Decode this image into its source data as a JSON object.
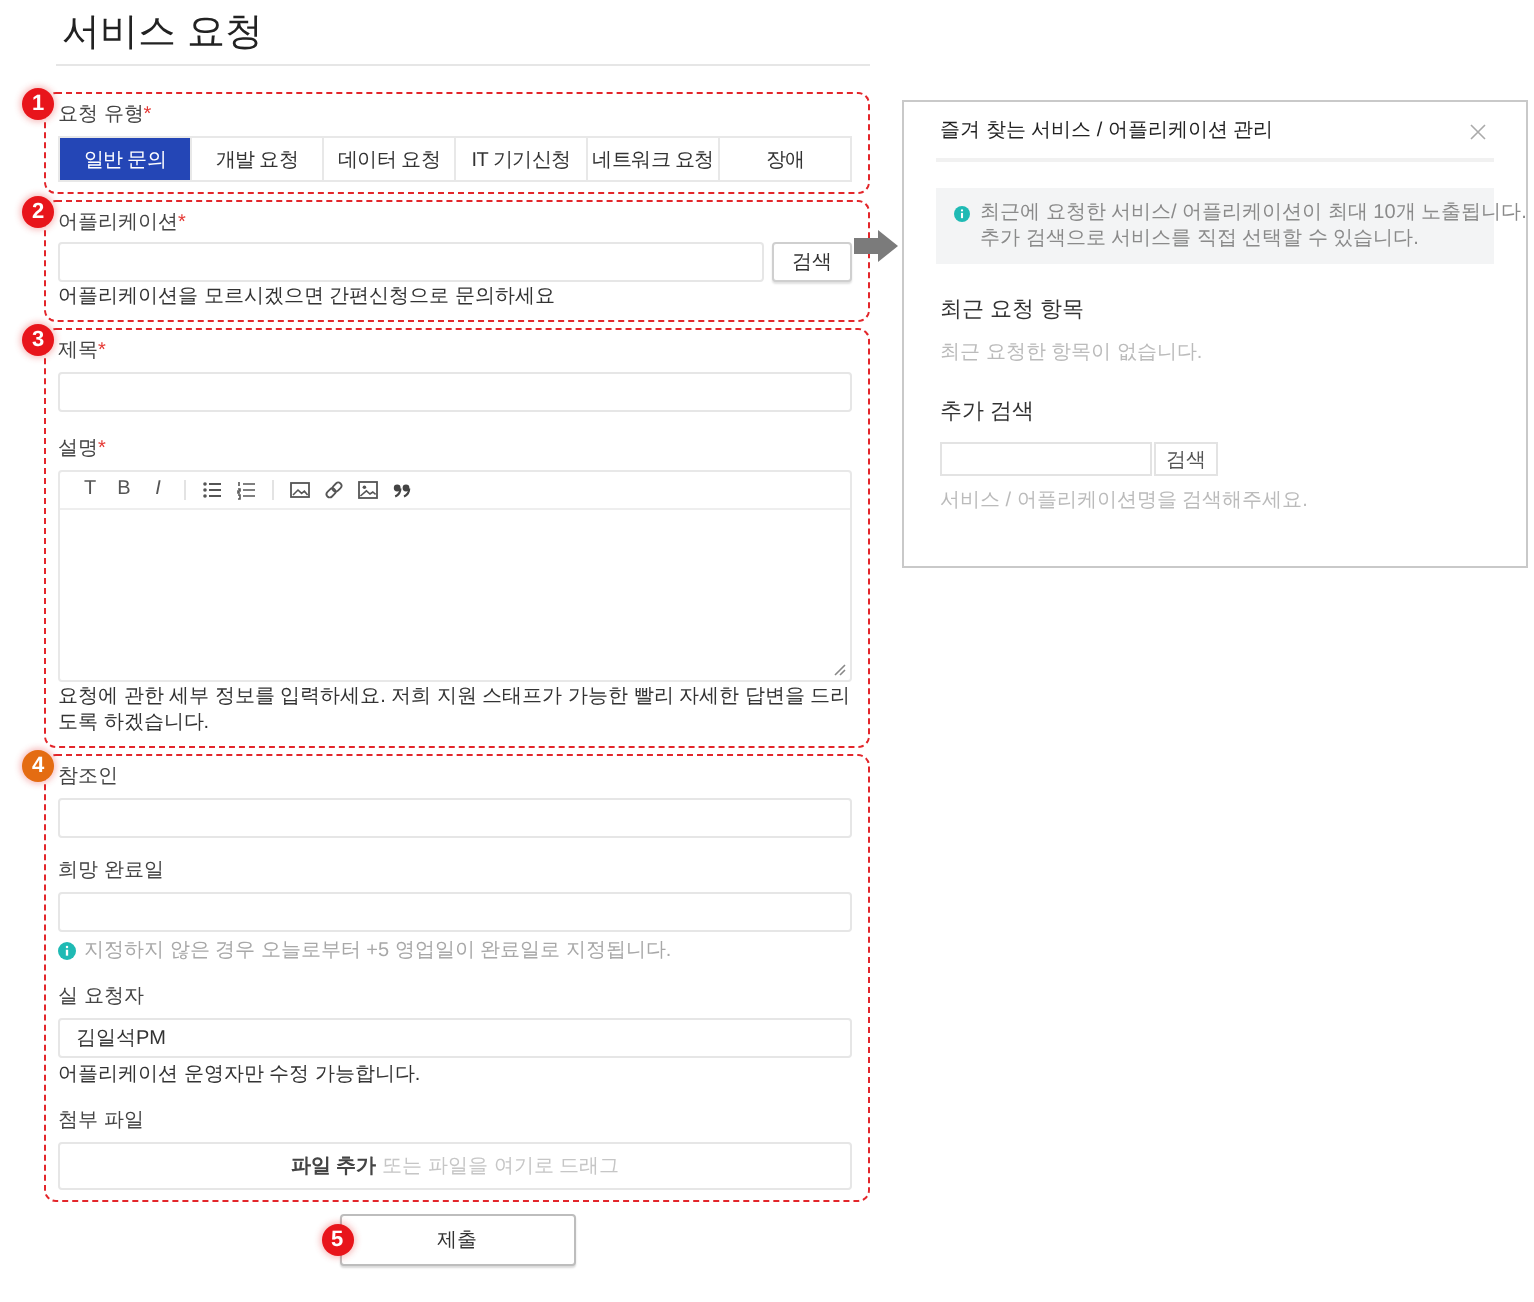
{
  "page_title": "서비스 요청",
  "markers": [
    {
      "label": "1",
      "color": "#e8151b"
    },
    {
      "label": "2",
      "color": "#e8151b"
    },
    {
      "label": "3",
      "color": "#e8151b"
    },
    {
      "label": "4",
      "color": "#e46c12"
    },
    {
      "label": "5",
      "color": "#e8151b"
    }
  ],
  "request_type": {
    "label": "요청 유형",
    "required_mark": "*",
    "tabs": [
      {
        "label": "일반 문의",
        "selected": true
      },
      {
        "label": "개발 요청",
        "selected": false
      },
      {
        "label": "데이터 요청",
        "selected": false
      },
      {
        "label": "IT 기기신청",
        "selected": false
      },
      {
        "label": "네트워크 요청",
        "selected": false
      },
      {
        "label": "장애",
        "selected": false
      }
    ]
  },
  "application": {
    "label": "어플리케이션",
    "required_mark": "*",
    "search_button": "검색",
    "help": "어플리케이션을 모르시겠으면 간편신청으로 문의하세요"
  },
  "subject": {
    "label": "제목",
    "required_mark": "*"
  },
  "description": {
    "label": "설명",
    "required_mark": "*",
    "toolbar": [
      [
        {
          "kind": "letter",
          "label": "T",
          "italic": false
        },
        {
          "kind": "letter",
          "label": "B",
          "italic": false
        },
        {
          "kind": "letter",
          "label": "I",
          "italic": true
        }
      ],
      [
        {
          "kind": "bullet-list"
        },
        {
          "kind": "number-list"
        }
      ],
      [
        {
          "kind": "image"
        },
        {
          "kind": "link"
        },
        {
          "kind": "media"
        },
        {
          "kind": "quote"
        }
      ]
    ],
    "help": "요청에 관한 세부 정보를 입력하세요. 저희 지원 스태프가 가능한 빨리 자세한 답변을 드리도록 하겠습니다."
  },
  "cc": {
    "label": "참조인"
  },
  "due_date": {
    "label": "희망 완료일",
    "note": "지정하지 않은 경우 오늘로부터 +5 영업일이 완료일로 지정됩니다."
  },
  "requester": {
    "label": "실 요청자",
    "value": "김일석PM",
    "note": "어플리케이션 운영자만 수정 가능합니다."
  },
  "attachment": {
    "label": "첨부 파일",
    "action": "파일 추가",
    "hint": "또는 파일을 여기로 드래그"
  },
  "submit_button": "제출",
  "favorites_panel": {
    "title": "즐겨 찾는 서비스 / 어플리케이션 관리",
    "notice": [
      "최근에 요청한 서비스/ 어플리케이션이 최대 10개 노출됩니다.",
      "추가 검색으로 서비스를 직접 선택할 수 있습니다."
    ],
    "recent_heading": "최근 요청 항목",
    "recent_empty": "최근 요청한 항목이 없습니다.",
    "search_heading": "추가 검색",
    "search_button": "검색",
    "search_hint": "서비스 / 어플리케이션명을 검색해주세요."
  }
}
